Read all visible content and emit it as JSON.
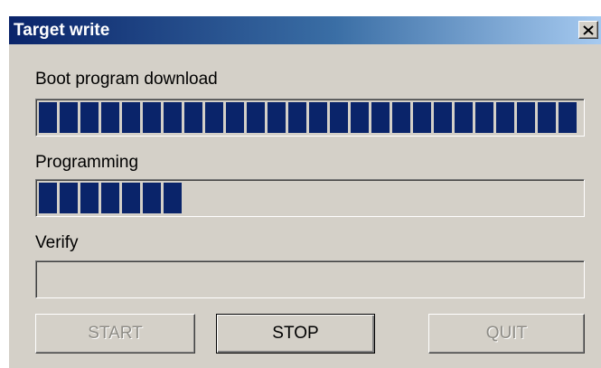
{
  "window": {
    "title": "Target write",
    "close_glyph": "×"
  },
  "sections": [
    {
      "label": "Boot program download",
      "progress": 1.0
    },
    {
      "label": "Programming",
      "progress": 0.3
    },
    {
      "label": "Verify",
      "progress": 0.0
    }
  ],
  "buttons": {
    "start": "START",
    "stop": "STOP",
    "quit": "QUIT"
  },
  "colors": {
    "progress_block": "#0a246a",
    "title_start": "#0a246a",
    "title_end": "#a6caf0"
  }
}
